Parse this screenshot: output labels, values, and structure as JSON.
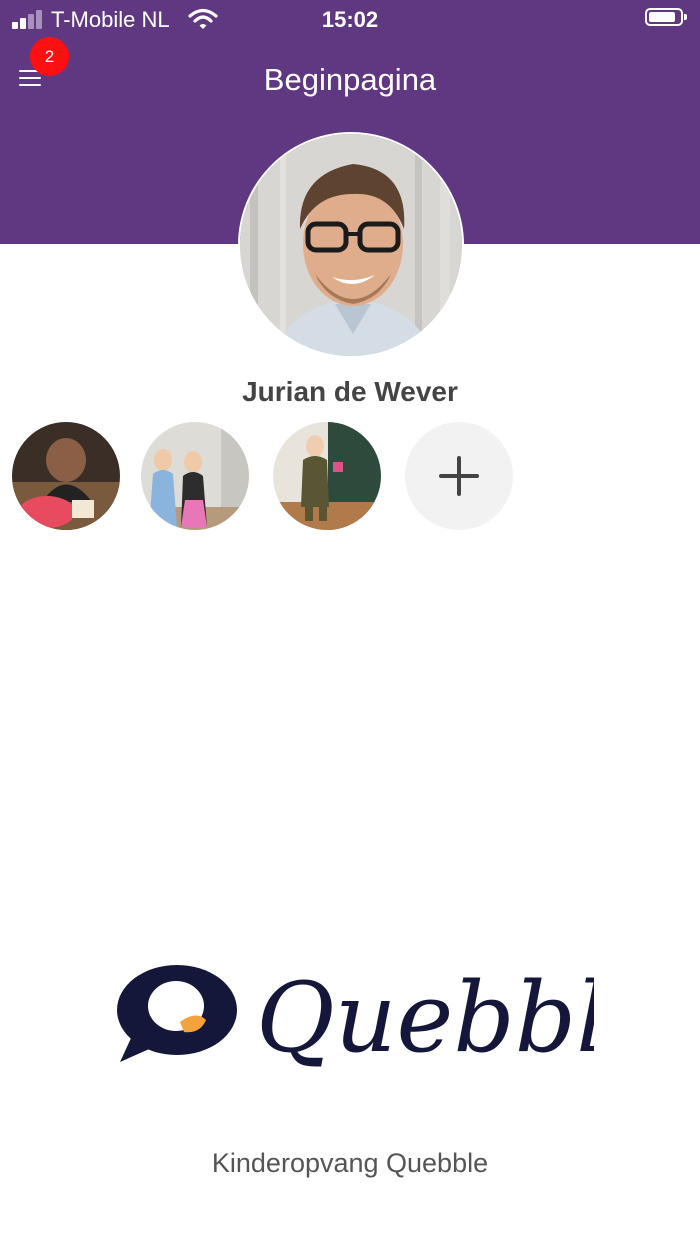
{
  "status_bar": {
    "carrier": "T-Mobile NL",
    "time": "15:02",
    "signal_bars_active": 2,
    "signal_bars_total": 4,
    "battery_level": 0.9,
    "icons": [
      "signal-icon",
      "wifi-icon",
      "battery-icon"
    ]
  },
  "header": {
    "title": "Beginpagina",
    "menu_icon": "hamburger-menu-icon",
    "notification_count": "2",
    "background_color": "#603882",
    "badge_color": "#ff1010"
  },
  "profile": {
    "name": "Jurian de Wever"
  },
  "children": [
    {
      "name": "child-1"
    },
    {
      "name": "child-2"
    },
    {
      "name": "child-3"
    }
  ],
  "add_child": {
    "icon": "plus-icon"
  },
  "branding": {
    "logo_text": "Quebble",
    "logo_color": "#14173a",
    "organization": "Kinderopvang Quebble"
  }
}
